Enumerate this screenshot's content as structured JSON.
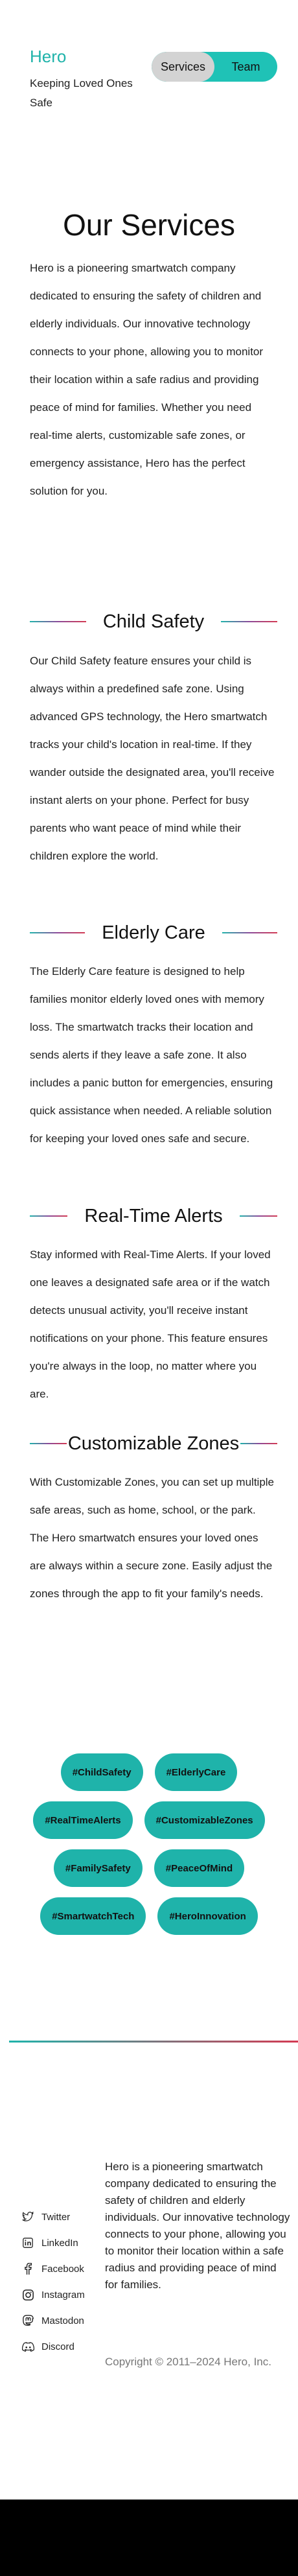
{
  "header": {
    "logo": "Hero",
    "tagline": "Keeping Loved Ones Safe",
    "toggle": {
      "services": "Services",
      "team": "Team",
      "active": "Services"
    }
  },
  "intro": {
    "title": "Our Services",
    "text": "Hero is a pioneering smartwatch company dedicated to ensuring the safety of children and elderly individuals. Our innovative technology connects to your phone, allowing you to monitor their location within a safe radius and providing peace of mind for families. Whether you need real-time alerts, customizable safe zones, or emergency assistance, Hero has the perfect solution for you."
  },
  "sections": [
    {
      "title": "Child Safety",
      "text": "Our Child Safety feature ensures your child is always within a predefined safe zone. Using advanced GPS technology, the Hero smartwatch tracks your child's location in real-time. If they wander outside the designated area, you'll receive instant alerts on your phone. Perfect for busy parents who want peace of mind while their children explore the world."
    },
    {
      "title": "Elderly Care",
      "text": "The Elderly Care feature is designed to help families monitor elderly loved ones with memory loss. The smartwatch tracks their location and sends alerts if they leave a safe zone. It also includes a panic button for emergencies, ensuring quick assistance when needed. A reliable solution for keeping your loved ones safe and secure."
    },
    {
      "title": "Real-Time Alerts",
      "text": "Stay informed with Real-Time Alerts. If your loved one leaves a designated safe area or if the watch detects unusual activity, you'll receive instant notifications on your phone. This feature ensures you're always in the loop, no matter where you are."
    },
    {
      "title": "Customizable Zones",
      "text": "With Customizable Zones, you can set up multiple safe areas, such as home, school, or the park. The Hero smartwatch ensures your loved ones are always within a secure zone. Easily adjust the zones through the app to fit your family's needs."
    }
  ],
  "tags": [
    [
      "#ChildSafety",
      "#ElderlyCare"
    ],
    [
      "#RealTimeAlerts",
      "#CustomizableZones"
    ],
    [
      "#FamilySafety",
      "#PeaceOfMind"
    ],
    [
      "#SmartwatchTech",
      "#HeroInnovation"
    ]
  ],
  "footer": {
    "social": [
      {
        "label": "Twitter",
        "icon": "twitter-icon"
      },
      {
        "label": "LinkedIn",
        "icon": "linkedin-icon"
      },
      {
        "label": "Facebook",
        "icon": "facebook-icon"
      },
      {
        "label": "Instagram",
        "icon": "instagram-icon"
      },
      {
        "label": "Mastodon",
        "icon": "mastodon-icon"
      },
      {
        "label": "Discord",
        "icon": "discord-icon"
      }
    ],
    "about": "Hero is a pioneering smartwatch company dedicated to ensuring the safety of children and elderly individuals. Our innovative technology connects to your phone, allowing you to monitor their location within a safe radius and providing peace of mind for families.",
    "copyright": "Copyright © 2011–2024 Hero, Inc."
  },
  "colors": {
    "accent": "#1fb3aa",
    "toggle_bg": "#1fc2b6",
    "toggle_active": "#d3d3d3",
    "gradient_end": "#d43a52"
  }
}
